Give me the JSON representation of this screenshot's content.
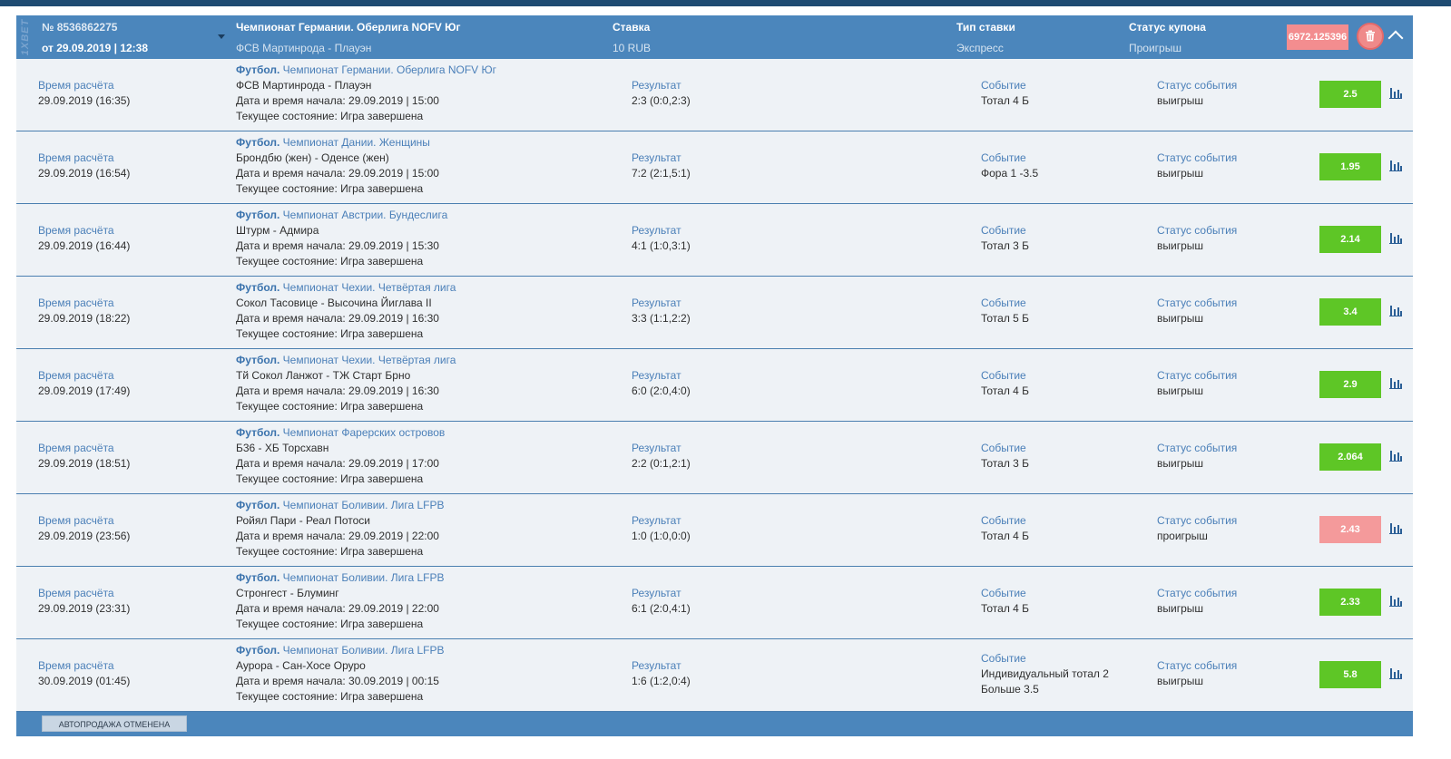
{
  "header": {
    "brand": "1XBET",
    "coupon_number": "№ 8536862275",
    "coupon_date": "от 29.09.2019 | 12:38",
    "championship": "Чемпионат Германии. Оберлига NOFV Юг",
    "match": "ФСВ Мартинрода - Плауэн",
    "stake_label": "Ставка",
    "stake_value": "10 RUB",
    "bet_type_label": "Тип ставки",
    "bet_type_value": "Экспресс",
    "status_label": "Статус купона",
    "status_value": "Проигрыш",
    "total_odds": "6972.125396",
    "delete_icon": "trash-icon",
    "collapse_icon": "chevron-up-icon"
  },
  "labels": {
    "calc_time": "Время расчёта",
    "result": "Результат",
    "event": "Событие",
    "event_status": "Статус события",
    "start_prefix": "Дата и время начала: ",
    "state_prefix": "Текущее состояние: "
  },
  "colors": {
    "win": "#5ec626",
    "lose": "#f49a9b",
    "header": "#4b86bc"
  },
  "rows": [
    {
      "calc_time": "29.09.2019 (16:35)",
      "sport": "Футбол.",
      "champ": " Чемпионат Германии. Оберлига NOFV Юг",
      "teams": "ФСВ Мартинрода - Плауэн",
      "start": "Дата и время начала: 29.09.2019 | 15:00",
      "state": "Текущее состояние: Игра завершена",
      "result": "2:3 (0:0,2:3)",
      "event": "Тотал 4 Б",
      "event2": "",
      "status": "выигрыш",
      "odds": "2.5",
      "won": true
    },
    {
      "calc_time": "29.09.2019 (16:54)",
      "sport": "Футбол.",
      "champ": " Чемпионат Дании. Женщины",
      "teams": "Брондбю (жен) - Оденсе (жен)",
      "start": "Дата и время начала: 29.09.2019 | 15:00",
      "state": "Текущее состояние: Игра завершена",
      "result": "7:2 (2:1,5:1)",
      "event": "Фора 1 -3.5",
      "event2": "",
      "status": "выигрыш",
      "odds": "1.95",
      "won": true
    },
    {
      "calc_time": "29.09.2019 (16:44)",
      "sport": "Футбол.",
      "champ": " Чемпионат Австрии. Бундеслига",
      "teams": "Штурм - Адмира",
      "start": "Дата и время начала: 29.09.2019 | 15:30",
      "state": "Текущее состояние: Игра завершена",
      "result": "4:1 (1:0,3:1)",
      "event": "Тотал 3 Б",
      "event2": "",
      "status": "выигрыш",
      "odds": "2.14",
      "won": true
    },
    {
      "calc_time": "29.09.2019 (18:22)",
      "sport": "Футбол.",
      "champ": " Чемпионат Чехии. Четвёртая лига",
      "teams": "Сокол Тасовице - Высочина Йиглава II",
      "start": "Дата и время начала: 29.09.2019 | 16:30",
      "state": "Текущее состояние: Игра завершена",
      "result": "3:3 (1:1,2:2)",
      "event": "Тотал 5 Б",
      "event2": "",
      "status": "выигрыш",
      "odds": "3.4",
      "won": true
    },
    {
      "calc_time": "29.09.2019 (17:49)",
      "sport": "Футбол.",
      "champ": " Чемпионат Чехии. Четвёртая лига",
      "teams": "Тй Сокол Ланжот - ТЖ Старт Брно",
      "start": "Дата и время начала: 29.09.2019 | 16:30",
      "state": "Текущее состояние: Игра завершена",
      "result": "6:0 (2:0,4:0)",
      "event": "Тотал 4 Б",
      "event2": "",
      "status": "выигрыш",
      "odds": "2.9",
      "won": true
    },
    {
      "calc_time": "29.09.2019 (18:51)",
      "sport": "Футбол.",
      "champ": " Чемпионат Фарерских островов",
      "teams": "Б36 - ХБ Торсхавн",
      "start": "Дата и время начала: 29.09.2019 | 17:00",
      "state": "Текущее состояние: Игра завершена",
      "result": "2:2 (0:1,2:1)",
      "event": "Тотал 3 Б",
      "event2": "",
      "status": "выигрыш",
      "odds": "2.064",
      "won": true
    },
    {
      "calc_time": "29.09.2019 (23:56)",
      "sport": "Футбол.",
      "champ": " Чемпионат Боливии. Лига LFPB",
      "teams": "Ройял Пари - Реал Потоси",
      "start": "Дата и время начала: 29.09.2019 | 22:00",
      "state": "Текущее состояние: Игра завершена",
      "result": "1:0 (1:0,0:0)",
      "event": "Тотал 4 Б",
      "event2": "",
      "status": "проигрыш",
      "odds": "2.43",
      "won": false
    },
    {
      "calc_time": "29.09.2019 (23:31)",
      "sport": "Футбол.",
      "champ": " Чемпионат Боливии. Лига LFPB",
      "teams": "Стронгест - Блуминг",
      "start": "Дата и время начала: 29.09.2019 | 22:00",
      "state": "Текущее состояние: Игра завершена",
      "result": "6:1 (2:0,4:1)",
      "event": "Тотал 4 Б",
      "event2": "",
      "status": "выигрыш",
      "odds": "2.33",
      "won": true
    },
    {
      "calc_time": "30.09.2019 (01:45)",
      "sport": "Футбол.",
      "champ": " Чемпионат Боливии. Лига LFPB",
      "teams": "Аурора - Сан-Хосе Оруро",
      "start": "Дата и время начала: 30.09.2019 | 00:15",
      "state": "Текущее состояние: Игра завершена",
      "result": "1:6 (1:2,0:4)",
      "event": "Индивидуальный тотал 2",
      "event2": "Больше 3.5",
      "status": "выигрыш",
      "odds": "5.8",
      "won": true
    }
  ],
  "footer": {
    "autosale_label": "АВТОПРОДАЖА ОТМЕНЕНА"
  }
}
